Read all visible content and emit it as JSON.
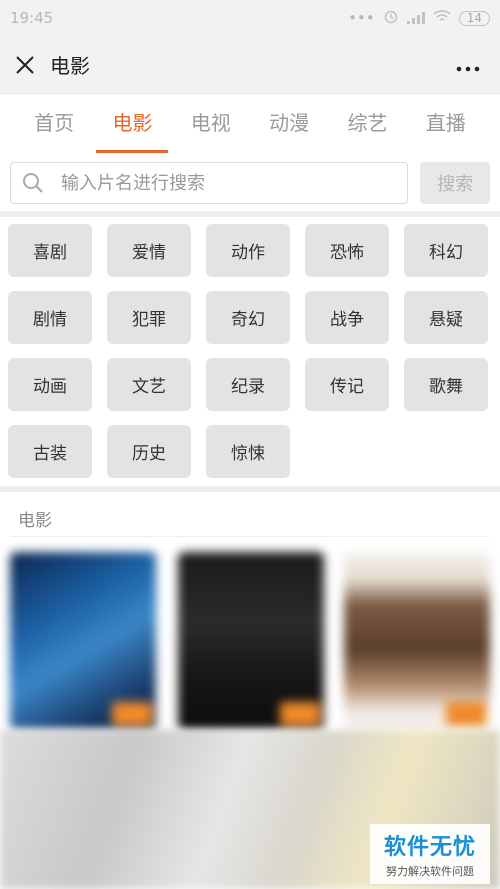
{
  "status_bar": {
    "time": "19:45",
    "battery": "14"
  },
  "title_bar": {
    "title": "电影",
    "close_icon": "close-icon",
    "more_icon": "more-icon"
  },
  "tabs": [
    {
      "label": "首页",
      "active": false
    },
    {
      "label": "电影",
      "active": true
    },
    {
      "label": "电视",
      "active": false
    },
    {
      "label": "动漫",
      "active": false
    },
    {
      "label": "综艺",
      "active": false
    },
    {
      "label": "直播",
      "active": false
    }
  ],
  "search": {
    "placeholder": "输入片名进行搜索",
    "value": "",
    "button_label": "搜索"
  },
  "genres": [
    "喜剧",
    "爱情",
    "动作",
    "恐怖",
    "科幻",
    "剧情",
    "犯罪",
    "奇幻",
    "战争",
    "悬疑",
    "动画",
    "文艺",
    "纪录",
    "传记",
    "歌舞",
    "古装",
    "历史",
    "惊悚"
  ],
  "section": {
    "title": "电影"
  },
  "watermark": {
    "main": "软件无忧",
    "sub": "努力解决软件问题"
  },
  "colors": {
    "accent": "#e8672a",
    "watermark": "#1a8fd6"
  }
}
